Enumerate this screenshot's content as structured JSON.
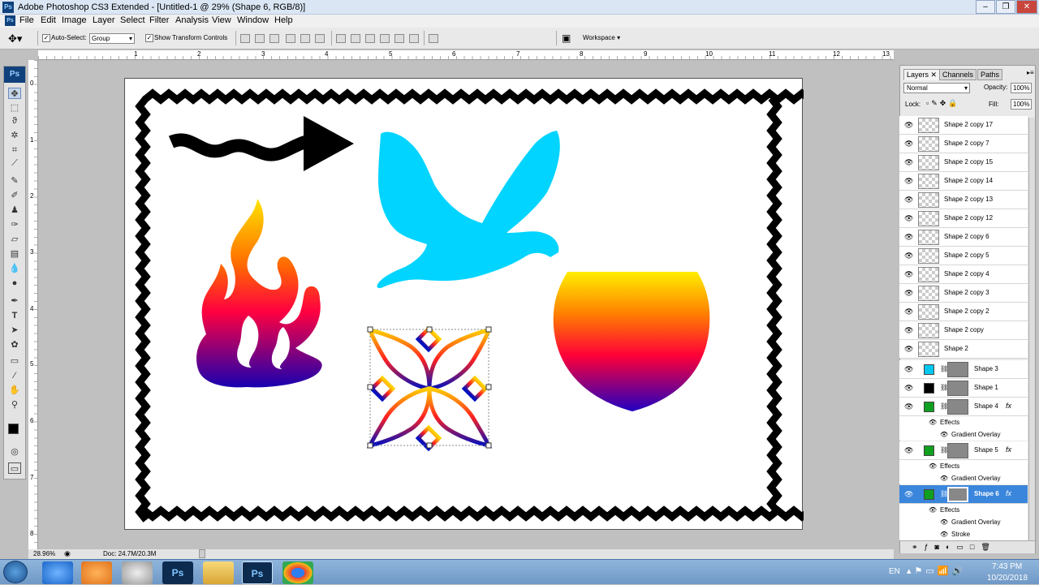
{
  "window": {
    "title": "Adobe Photoshop CS3 Extended - [Untitled-1 @ 29% (Shape 6, RGB/8)]",
    "app_badge": "Ps"
  },
  "menu": [
    "File",
    "Edit",
    "Image",
    "Layer",
    "Select",
    "Filter",
    "Analysis",
    "View",
    "Window",
    "Help"
  ],
  "options": {
    "auto_select_label": "Auto-Select:",
    "auto_select_value": "Group",
    "transform_label": "Show Transform Controls",
    "workspace_label": "Workspace"
  },
  "status": {
    "zoom": "28.96%",
    "doc": "Doc: 24.7M/20.3M"
  },
  "layers_panel": {
    "tabs": [
      "Layers",
      "Channels",
      "Paths"
    ],
    "blend_mode": "Normal",
    "opacity_label": "Opacity:",
    "opacity": "100%",
    "lock_label": "Lock:",
    "fill_label": "Fill:",
    "fill": "100%",
    "layers": [
      {
        "name": "Shape 2 copy 17"
      },
      {
        "name": "Shape 2 copy 7"
      },
      {
        "name": "Shape 2 copy 15"
      },
      {
        "name": "Shape 2 copy 14"
      },
      {
        "name": "Shape 2 copy 13"
      },
      {
        "name": "Shape 2 copy 12"
      },
      {
        "name": "Shape 2 copy 6"
      },
      {
        "name": "Shape 2 copy 5"
      },
      {
        "name": "Shape 2 copy 4"
      },
      {
        "name": "Shape 2 copy 3"
      },
      {
        "name": "Shape 2 copy 2"
      },
      {
        "name": "Shape 2 copy"
      },
      {
        "name": "Shape 2"
      }
    ],
    "shape_layers": [
      {
        "name": "Shape 3",
        "color": "#00c8f0"
      },
      {
        "name": "Shape 1",
        "color": "#000000"
      },
      {
        "name": "Shape 4",
        "color": "#10a020",
        "fx": "fx",
        "effects": [
          "Effects",
          "Gradient Overlay"
        ]
      },
      {
        "name": "Shape 5",
        "color": "#10a020",
        "fx": "fx",
        "effects": [
          "Effects",
          "Gradient Overlay"
        ]
      },
      {
        "name": "Shape 6",
        "color": "#10a020",
        "fx": "fx",
        "effects": [
          "Effects",
          "Gradient Overlay",
          "Stroke"
        ]
      }
    ]
  },
  "tray": {
    "lang": "EN",
    "time": "7:43 PM",
    "date": "10/20/2018"
  },
  "ruler_top": [
    "1",
    "2",
    "3",
    "4",
    "5",
    "6",
    "7",
    "8",
    "9",
    "10",
    "11",
    "12",
    "13"
  ],
  "ruler_left": [
    "0",
    "1",
    "2",
    "3",
    "4",
    "5",
    "6",
    "7",
    "8"
  ]
}
